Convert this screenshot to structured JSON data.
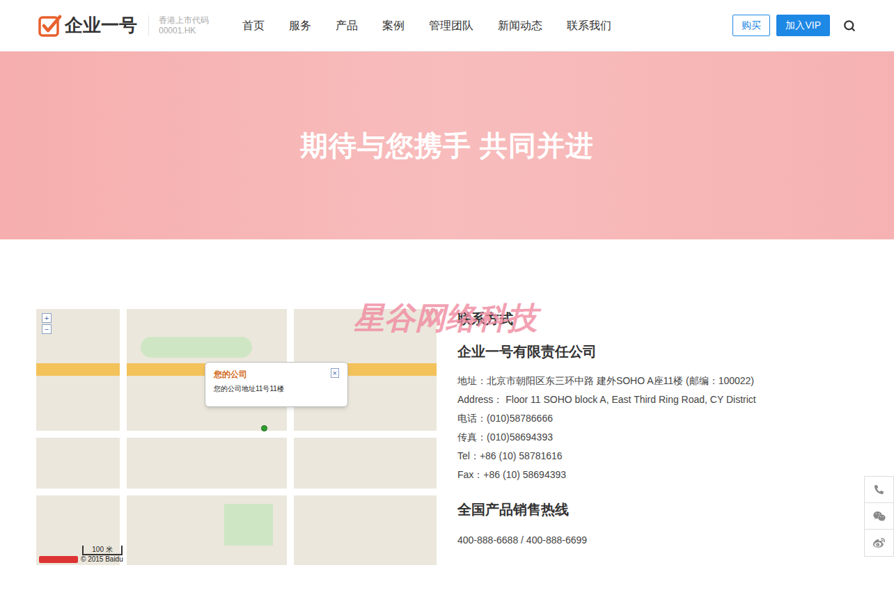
{
  "header": {
    "logo": "企业一号",
    "stock_label": "香港上市代码",
    "stock_code": "00001.HK",
    "nav": [
      {
        "label": "首页",
        "selected": false
      },
      {
        "label": "服务",
        "selected": false
      },
      {
        "label": "产品",
        "selected": false
      },
      {
        "label": "案例",
        "selected": false
      },
      {
        "label": "管理团队",
        "selected": false
      },
      {
        "label": "新闻动态",
        "selected": false
      },
      {
        "label": "联系我们",
        "selected": false
      }
    ],
    "buy_button": "购买",
    "vip_button": "加入VIP"
  },
  "hero": {
    "title": "期待与您携手 共同并进"
  },
  "map": {
    "popup_title": "您的公司",
    "popup_address": "您的公司地址11号11楼",
    "scale": "100 米",
    "copyright": "© 2015 Baidu",
    "zoom_in": "+",
    "zoom_out": "−",
    "close": "×"
  },
  "contact": {
    "heading": "联系方式",
    "company": "企业一号有限责任公司",
    "lines": [
      "地址：北京市朝阳区东三环中路 建外SOHO A座11楼 (邮编：100022)",
      "Address： Floor 11 SOHO block A, East Third Ring Road, CY District",
      "电话：(010)58786666",
      "传真：(010)58694393",
      "Tel：+86 (10) 58781616",
      "Fax：+86 (10) 58694393"
    ],
    "hotline_heading": "全国产品销售热线",
    "hotline": "400-888-6688 / 400-888-6699"
  },
  "watermark": "星谷网络科技"
}
